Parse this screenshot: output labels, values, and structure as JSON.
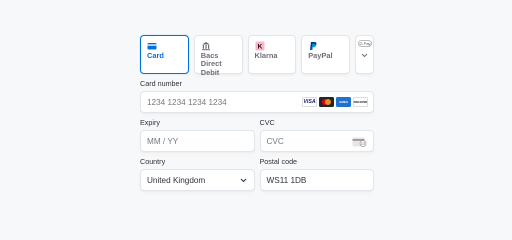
{
  "tabs": [
    {
      "label": "Card",
      "icon": "card-icon",
      "selected": true
    },
    {
      "label": "Bacs Direct Debit",
      "icon": "bank-icon",
      "selected": false
    },
    {
      "label": "Klarna",
      "icon": "klarna-icon",
      "selected": false
    },
    {
      "label": "PayPal",
      "icon": "paypal-icon",
      "selected": false
    }
  ],
  "more_tab": {
    "badge": "G Pay",
    "icon": "chevron-down-icon"
  },
  "card_number": {
    "label": "Card number",
    "placeholder": "1234 1234 1234 1234",
    "brands": [
      "VISA",
      "mastercard",
      "AMEX",
      "DISCOVER"
    ]
  },
  "expiry": {
    "label": "Expiry",
    "placeholder": "MM / YY"
  },
  "cvc": {
    "label": "CVC",
    "placeholder": "CVC"
  },
  "country": {
    "label": "Country",
    "value": "United Kingdom"
  },
  "postal": {
    "label": "Postal code",
    "value": "WS11 1DB"
  },
  "colors": {
    "accent": "#0570de",
    "background": "#f6f8fa",
    "border": "#e0e6eb",
    "text": "#30313d",
    "placeholder": "#77787f"
  }
}
